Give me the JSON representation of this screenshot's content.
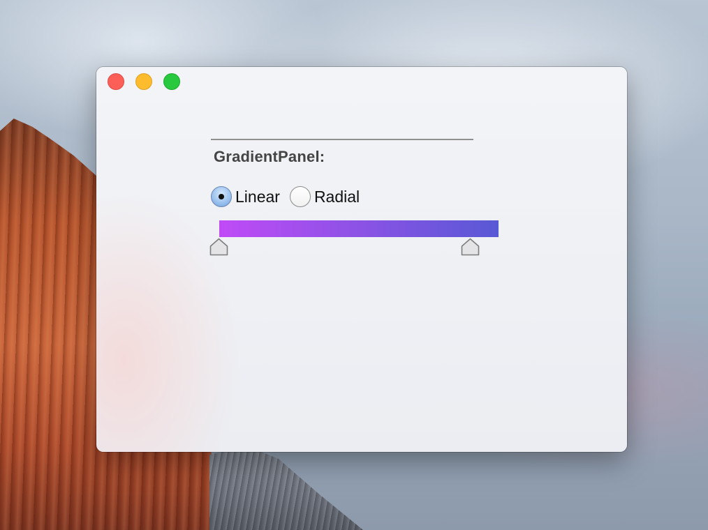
{
  "window": {
    "title": ""
  },
  "panel": {
    "label": "GradientPanel:"
  },
  "gradient_type": {
    "options": [
      {
        "label": "Linear",
        "selected": true
      },
      {
        "label": "Radial",
        "selected": false
      }
    ]
  },
  "gradient": {
    "start_color": "#c04bf6",
    "end_color": "#5859d5",
    "stops": [
      {
        "color": "#c04bf6",
        "position": 0
      },
      {
        "color": "#5859d5",
        "position": 1
      }
    ]
  },
  "colors": {
    "close": "#fc5f57",
    "minimize": "#fdbc2e",
    "zoom": "#28c83f"
  },
  "icons": {
    "close": "close-button-icon",
    "minimize": "minimize-button-icon",
    "zoom": "zoom-button-icon",
    "stop": "gradient-stop-handle-icon"
  }
}
